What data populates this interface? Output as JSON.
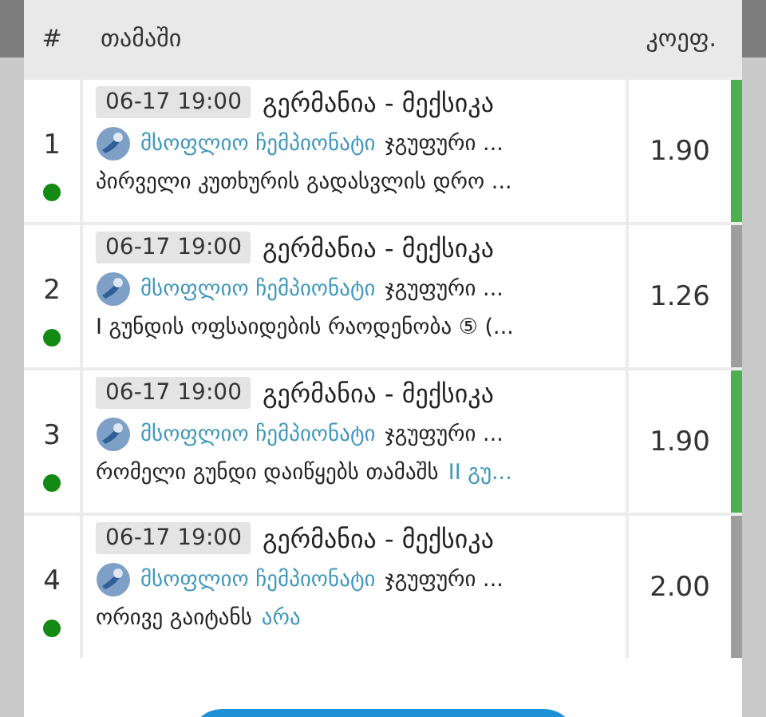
{
  "header": {
    "number": "#",
    "game": "თამაში",
    "odds": "კოეფ."
  },
  "rows": [
    {
      "number": "1",
      "date": "06-17 19:00",
      "match": "გერმანია - მექსიკა",
      "league": "მსოფლიო ჩემპიონატი",
      "stage": "ჯგუფური ...",
      "market": "პირველი კუთხურის გადასვლის დრო ...",
      "odds": "1.90",
      "color": "#4caf50"
    },
    {
      "number": "2",
      "date": "06-17 19:00",
      "match": "გერმანია - მექსიკა",
      "league": "მსოფლიო ჩემპიონატი",
      "stage": "ჯგუფური ...",
      "market": "I გუნდის ოფსაიდების რაოდენობა ⑤ (...",
      "odds": "1.26",
      "color": "#9e9e9e"
    },
    {
      "number": "3",
      "date": "06-17 19:00",
      "match": "გერმანია - მექსიკა",
      "league": "მსოფლიო ჩემპიონატი",
      "stage": "ჯგუფური ...",
      "market": "რომელი გუნდი დაიწყებს თამაშს",
      "selection": "II გუ...",
      "odds": "1.90",
      "color": "#4caf50"
    },
    {
      "number": "4",
      "date": "06-17 19:00",
      "match": "გერმანია - მექსიკა",
      "league": "მსოფლიო ჩემპიონატი",
      "stage": "ჯგუფური ...",
      "market": "ორივე გაიტანს",
      "selection": "არა",
      "odds": "2.00",
      "color": "#9e9e9e"
    }
  ]
}
